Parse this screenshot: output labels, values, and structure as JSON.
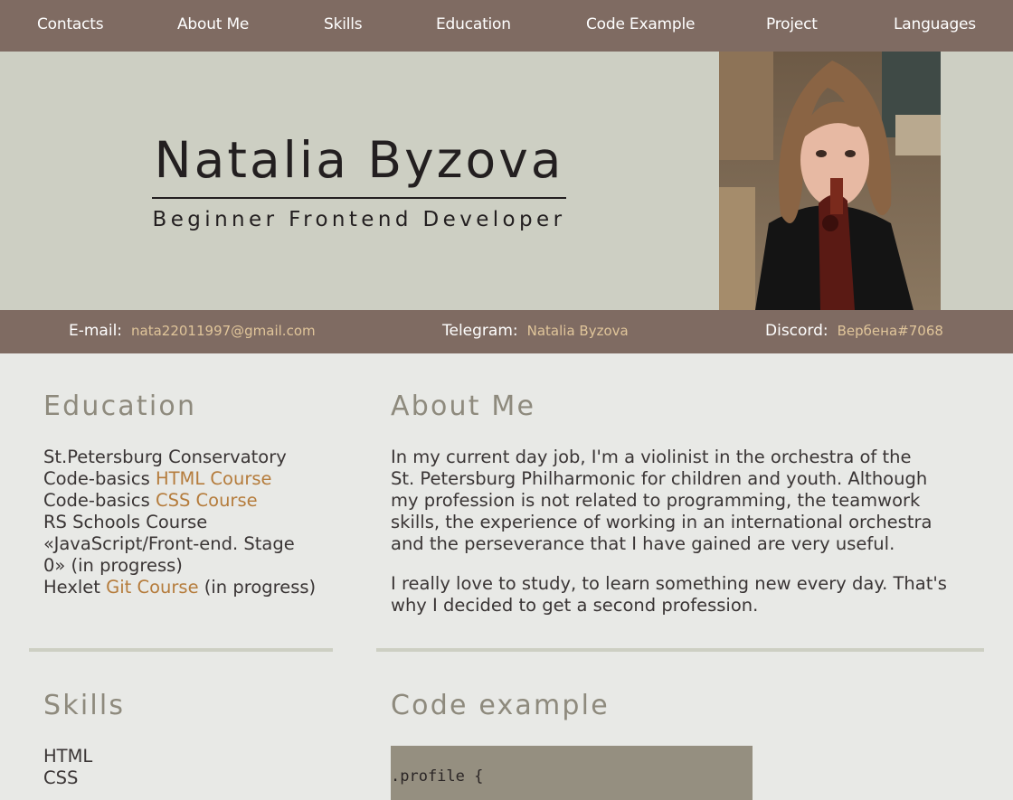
{
  "nav": {
    "items": [
      "Contacts",
      "About Me",
      "Skills",
      "Education",
      "Code Example",
      "Project",
      "Languages"
    ]
  },
  "hero": {
    "name": "Natalia Byzova",
    "subtitle": "Beginner Frontend Developer"
  },
  "contacts": {
    "email": {
      "label": "E-mail:",
      "value": "nata22011997@gmail.com"
    },
    "telegram": {
      "label": "Telegram:",
      "value": "Natalia Byzova"
    },
    "discord": {
      "label": "Discord:",
      "value": "Вербена#7068"
    }
  },
  "education": {
    "title": "Education",
    "line1": "St.Petersburg Conservatory",
    "line2_prefix": "Code-basics ",
    "line2_link": "HTML Course",
    "line3_prefix": "Code-basics ",
    "line3_link": "CSS Course",
    "line4": "RS Schools Course",
    "line5": "«JavaScript/Front-end. Stage",
    "line6": "0» (in progress)",
    "line7_prefix": "Hexlet ",
    "line7_link": "Git Course",
    "line7_suffix": " (in progress)"
  },
  "about": {
    "title": "About Me",
    "p1_l1": "In my current day job, I'm a violinist in the orchestra of the",
    "p1_l2": "St. Petersburg Philharmonic for children and youth. Although",
    "p1_l3": "my profession is not related to programming, the teamwork",
    "p1_l4": "skills, the experience of working in an international orchestra",
    "p1_l5": "and the perseverance that I have gained are very useful.",
    "p2_l1": "I really love to study, to learn something new every day. That's",
    "p2_l2": "why I decided to get a second profession."
  },
  "skills": {
    "title": "Skills",
    "items": [
      "HTML",
      "CSS"
    ]
  },
  "code": {
    "title": "Code example",
    "snippet": ".profile {"
  },
  "colors": {
    "nav_bg": "#7f6b62",
    "hero_bg": "#cdcfc3",
    "page_bg": "#e8e9e6",
    "link": "#b57c3c",
    "contact_value": "#e0c59a",
    "heading": "#8e8a7d",
    "code_bg": "#958f80"
  }
}
